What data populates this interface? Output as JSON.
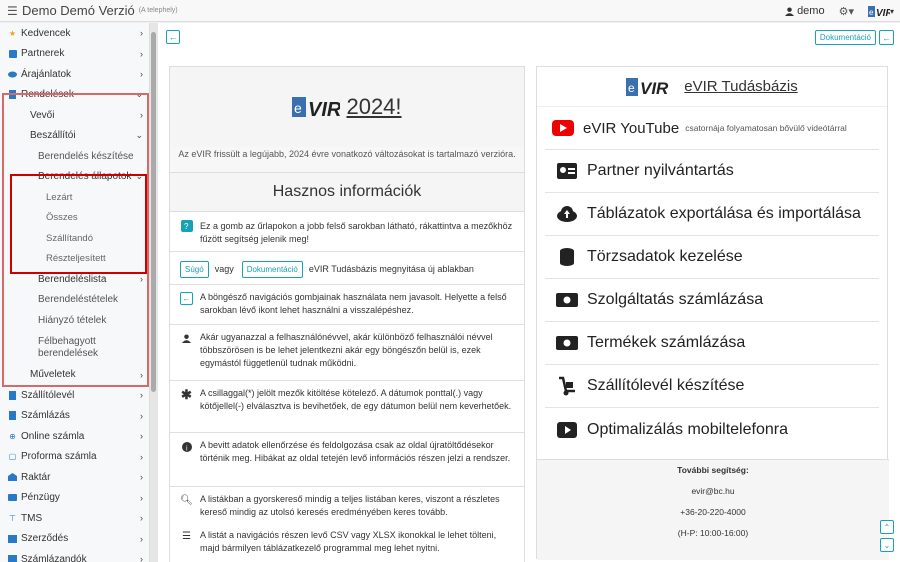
{
  "topbar": {
    "title": "Demo Demó Verzió",
    "subtitle": "(A telephely)",
    "user": "demo"
  },
  "sidebar": {
    "items": [
      {
        "label": "Kedvencek",
        "icon": "star-icon",
        "color": "#f0a020"
      },
      {
        "label": "Partnerek",
        "icon": "id-card-icon",
        "color": "#2979c9"
      },
      {
        "label": "Árajánlatok",
        "icon": "handshake-icon",
        "color": "#2979c9"
      },
      {
        "label": "Rendelések",
        "icon": "document-icon",
        "color": "#2979c9"
      },
      {
        "label": "Vevői"
      },
      {
        "label": "Beszállítói"
      },
      {
        "label": "Berendelés készítése"
      },
      {
        "label": "Berendelés állapotok"
      },
      {
        "label": "Lezárt"
      },
      {
        "label": "Összes"
      },
      {
        "label": "Szállítandó"
      },
      {
        "label": "Részteljesített"
      },
      {
        "label": "Berendeléslista"
      },
      {
        "label": "Berendeléstételek"
      },
      {
        "label": "Hiányzó tételek"
      },
      {
        "label": "Félbehagyott berendelések"
      },
      {
        "label": "Műveletek"
      },
      {
        "label": "Szállítólevél",
        "icon": "document-icon",
        "color": "#2979c9"
      },
      {
        "label": "Számlázás",
        "icon": "invoice-icon",
        "color": "#2979c9"
      },
      {
        "label": "Online számla",
        "icon": "globe-icon",
        "color": "#2979c9"
      },
      {
        "label": "Proforma számla",
        "icon": "file-icon",
        "color": "#2979c9"
      },
      {
        "label": "Raktár",
        "icon": "warehouse-icon",
        "color": "#2979c9"
      },
      {
        "label": "Pénzügy",
        "icon": "money-icon",
        "color": "#2979c9"
      },
      {
        "label": "TMS",
        "icon": "pin-icon",
        "color": "#2979c9"
      },
      {
        "label": "Szerződés",
        "icon": "contract-icon",
        "color": "#2979c9"
      },
      {
        "label": "Számlázandók",
        "icon": "invoice-icon",
        "color": "#2979c9"
      }
    ]
  },
  "main": {
    "doc_button": "Dokumentáció",
    "left": {
      "hero_year": "2024!",
      "hero_desc": "Az eVIR frissült a legújabb, 2024 évre vonatkozó változásokat is tartalmazó verzióra.",
      "section_title": "Hasznos információk",
      "help_text": "Ez a gomb az űrlapokon a jobb felső sarokban látható, rákattintva a mezőkhöz fűzött segítség jelenik meg!",
      "badge_sugo": "Súgó",
      "vagy": "vagy",
      "badge_doc": "Dokumentáció",
      "badge_text": "eVIR Tudásbázis megnyitása új ablakban",
      "nav_text": "A böngésző navigációs gombjainak használata nem javasolt. Helyette a felső sarokban lévő ikont lehet használni a visszalépéshez.",
      "user_text": "Akár ugyanazzal a felhasználónévvel, akár különböző felhasználói névvel többszörösen is be lehet jelentkezni akár egy böngészőn belül is, ezek egymástól függetlenül tudnak működni.",
      "star_text": "A csillaggal(*) jelölt mezők kitöltése kötelező. A dátumok ponttal(.) vagy kötőjellel(-) elválasztva is bevihetőek, de egy dátumon belül nem keverhetőek.",
      "info_text": "A bevitt adatok ellenőrzése és feldolgozása csak az oldal újratöltődésekor történik meg. Hibákat az oldal tetején levő információs részen jelzi a rendszer.",
      "search_text": "A listákban a gyorskereső mindig a teljes listában keres, viszont a részletes kereső mindig az utolsó keresés eredményében keres tovább.",
      "list_text": "A listát a navigációs részen levő CSV vagy XLSX ikonokkal le lehet tölteni, majd bármilyen táblázatkezelő programmal meg lehet nyitni."
    },
    "right": {
      "title": "eVIR Tudásbázis",
      "youtube": "eVIR YouTube",
      "youtube_small": "csatornája folyamatosan bővülő videótárral",
      "rows": [
        "Partner nyilvántartás",
        "Táblázatok exportálása és importálása",
        "Törzsadatok kezelése",
        "Szolgáltatás számlázása",
        "Termékek számlázása",
        "Szállítólevél készítése",
        "Optimalizálás mobiltelefonra"
      ],
      "footer_title": "További segítség:",
      "email": "evir@bc.hu",
      "phone": "+36-20-220-4000",
      "hours": "(H-P: 10:00-16:00)"
    }
  }
}
